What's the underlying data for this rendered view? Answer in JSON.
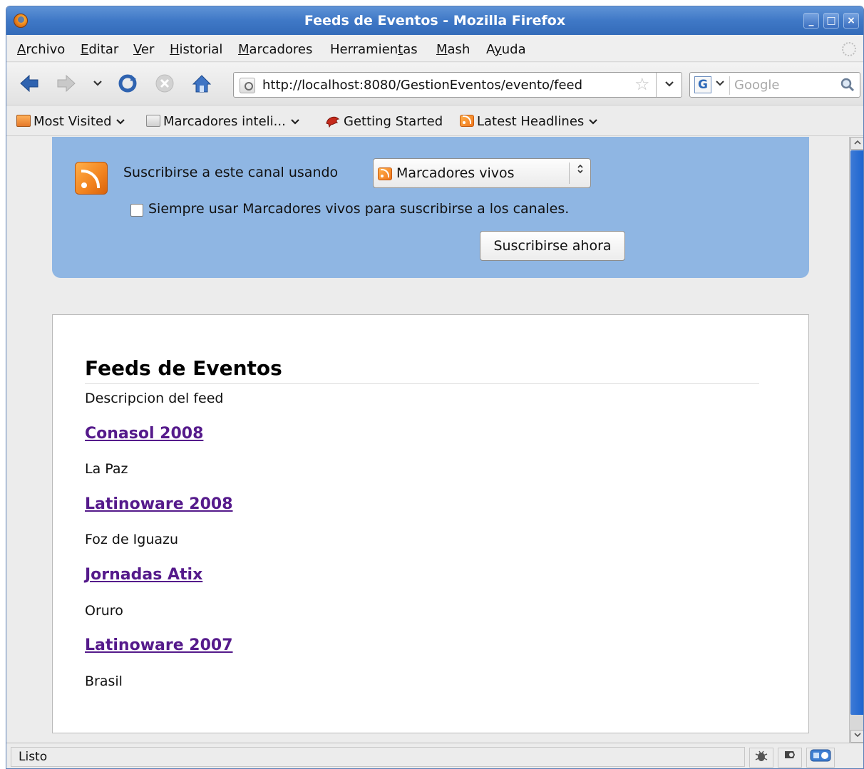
{
  "window": {
    "title": "Feeds de Eventos - Mozilla Firefox",
    "controls": {
      "minimize": "_",
      "maximize": "□",
      "close": "×"
    }
  },
  "menubar": {
    "items": [
      {
        "pre": "",
        "u": "A",
        "post": "rchivo"
      },
      {
        "pre": "",
        "u": "E",
        "post": "ditar"
      },
      {
        "pre": "",
        "u": "V",
        "post": "er"
      },
      {
        "pre": "",
        "u": "H",
        "post": "istorial"
      },
      {
        "pre": "",
        "u": "M",
        "post": "arcadores"
      },
      {
        "pre": "Herramien",
        "u": "t",
        "post": "as"
      },
      {
        "pre": "",
        "u": "M",
        "post": "ash"
      },
      {
        "pre": "A",
        "u": "y",
        "post": "uda"
      }
    ]
  },
  "navigation": {
    "url": "http://localhost:8080/GestionEventos/evento/feed",
    "search_placeholder": "Google",
    "search_engine_letter": "G"
  },
  "bookmarks": {
    "items": [
      "Most Visited",
      "Marcadores inteli...",
      "Getting Started",
      "Latest Headlines"
    ]
  },
  "subscribe": {
    "label": "Suscribirse a este canal usando",
    "reader_selected": "Marcadores vivos",
    "always_label": "Siempre usar Marcadores vivos para suscribirse a los canales.",
    "always_checked": false,
    "button": "Suscribirse ahora"
  },
  "feed": {
    "title": "Feeds de Eventos",
    "description": "Descripcion del feed",
    "entries": [
      {
        "title": "Conasol 2008",
        "text": "La Paz"
      },
      {
        "title": "Latinoware 2008",
        "text": "Foz de Iguazu"
      },
      {
        "title": "Jornadas Atix",
        "text": "Oruro"
      },
      {
        "title": "Latinoware 2007",
        "text": "Brasil"
      }
    ]
  },
  "status": {
    "text": "Listo"
  },
  "colors": {
    "titlebar": "#3f78c6",
    "feed_header_bg": "#8fb6e3",
    "link_visited": "#551a8b",
    "scroll_thumb": "#1a63cf"
  }
}
